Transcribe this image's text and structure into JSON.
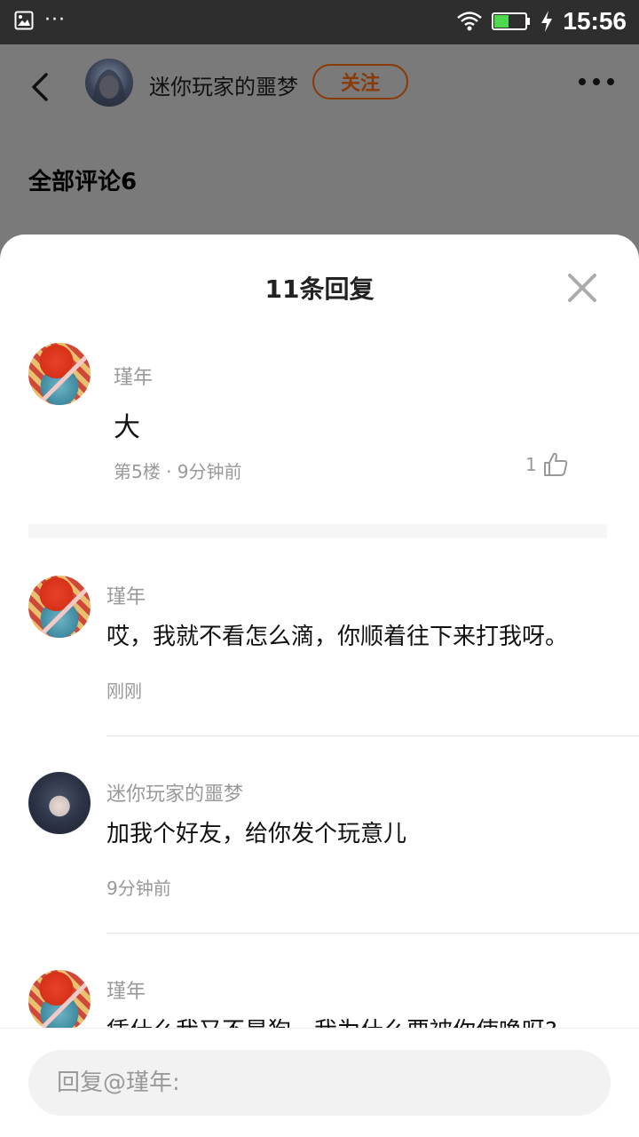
{
  "status_bar": {
    "time": "15:56",
    "overflow": "···",
    "icons": [
      "image-icon",
      "wifi-icon",
      "battery-icon",
      "charging-icon"
    ]
  },
  "app_header": {
    "author_name": "迷你玩家的噩梦",
    "follow_label": "关注",
    "comments_title": "全部评论6"
  },
  "sheet": {
    "title": "11条回复",
    "main_comment": {
      "user": "瑾年",
      "text": "大",
      "meta": "第5楼 · 9分钟前",
      "likes": "1"
    },
    "replies": [
      {
        "user": "瑾年",
        "text": "哎，我就不看怎么滴，你顺着往下来打我呀。",
        "time": "刚刚",
        "avatar": "red"
      },
      {
        "user": "迷你玩家的噩梦",
        "text": "加我个好友，给你发个玩意儿",
        "time": "9分钟前",
        "avatar": "dark"
      },
      {
        "user": "瑾年",
        "text": "凭什么我又不是狗，我为什么要被你使唤呀?",
        "time": "",
        "avatar": "red"
      }
    ]
  },
  "reply_bar": {
    "placeholder": "回复@瑾年:"
  },
  "colors": {
    "accent": "#8a3a06",
    "overlay": "#7a7a7a",
    "muted_text": "#999999"
  }
}
